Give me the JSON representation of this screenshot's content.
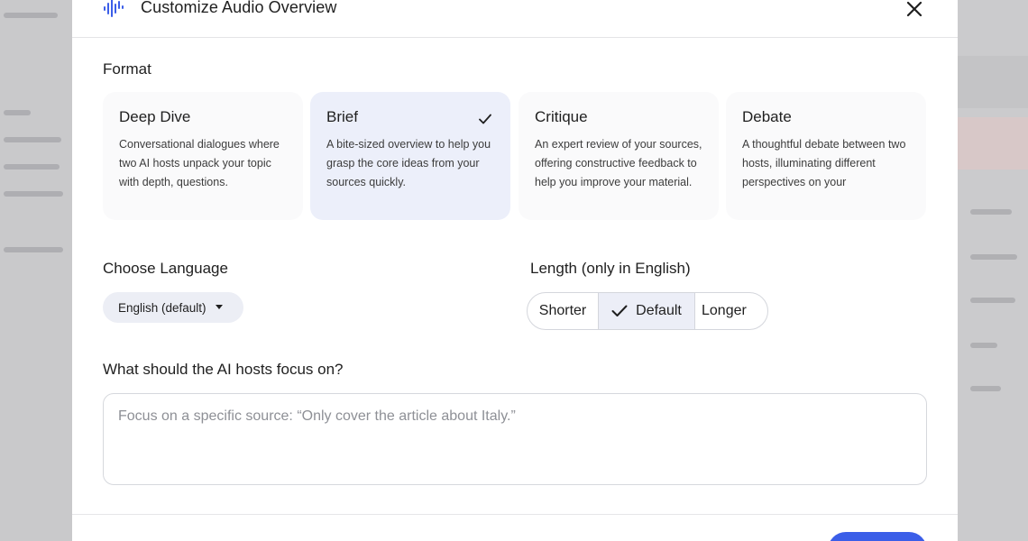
{
  "dialog": {
    "title": "Customize Audio Overview",
    "accent_color": "#3b5ee8"
  },
  "format": {
    "label": "Format",
    "options": [
      {
        "title": "Deep Dive",
        "description": "Conversational dialogues where two AI hosts unpack your topic with depth, questions.",
        "selected": false
      },
      {
        "title": "Brief",
        "description": "A bite-sized overview to help you grasp the core ideas from your sources quickly.",
        "selected": true
      },
      {
        "title": "Critique",
        "description": "An expert review of your sources, offering constructive feedback to help you improve your material.",
        "selected": false
      },
      {
        "title": "Debate",
        "description": "A thoughtful debate between two hosts, illuminating different perspectives on your",
        "selected": false
      }
    ]
  },
  "language": {
    "label": "Choose Language",
    "selected": "English (default)"
  },
  "length": {
    "label": "Length (only in English)",
    "options": [
      "Shorter",
      "Default",
      "Longer"
    ],
    "selected": "Default"
  },
  "focus": {
    "label": "What should the AI hosts focus on?",
    "placeholder": "Focus on a specific source: “Only cover the article about Italy.”",
    "value": ""
  },
  "icons": {
    "logo": "audio-waveform-icon",
    "close": "close-icon",
    "check": "check-icon",
    "caret": "caret-down-icon"
  }
}
